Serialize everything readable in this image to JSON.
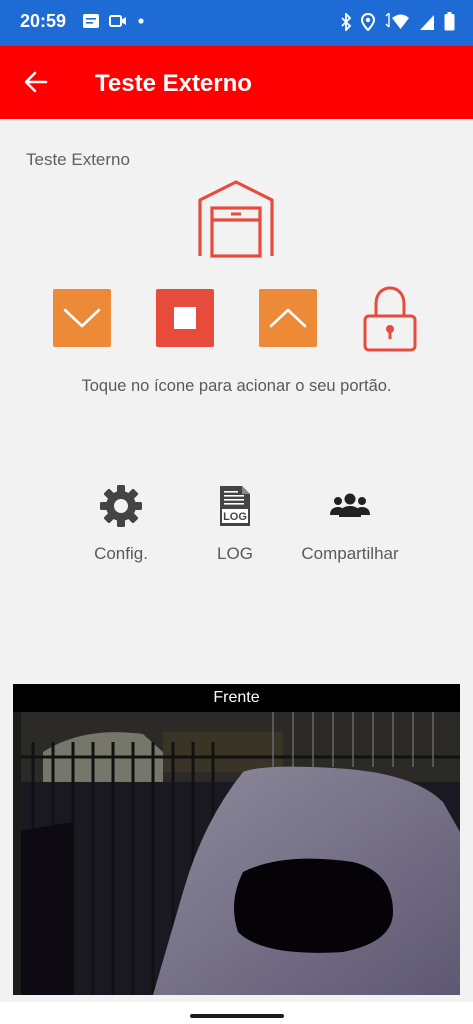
{
  "status_bar": {
    "time": "20:59",
    "left_icons": [
      "message-icon",
      "video-icon",
      "dot-icon"
    ],
    "right_icons": [
      "bluetooth-icon",
      "location-icon",
      "wifi-icon",
      "signal-icon",
      "battery-icon"
    ]
  },
  "app_bar": {
    "title": "Teste Externo",
    "background": "#ff0000"
  },
  "device": {
    "name": "Teste Externo"
  },
  "controls": {
    "down_label": "close-gate",
    "stop_label": "stop-gate",
    "up_label": "open-gate",
    "colors": {
      "down": "#ec8a38",
      "stop": "#e64b3c",
      "up": "#ec8a38",
      "lock": "#e64b3c"
    }
  },
  "hint": "Toque no ícone para acionar o seu portão.",
  "actions": [
    {
      "label": "Config.",
      "icon": "gear-icon"
    },
    {
      "label": "LOG",
      "icon": "log-icon"
    },
    {
      "label": "Compartilhar",
      "icon": "group-icon"
    }
  ],
  "camera": {
    "label": "Frente"
  }
}
